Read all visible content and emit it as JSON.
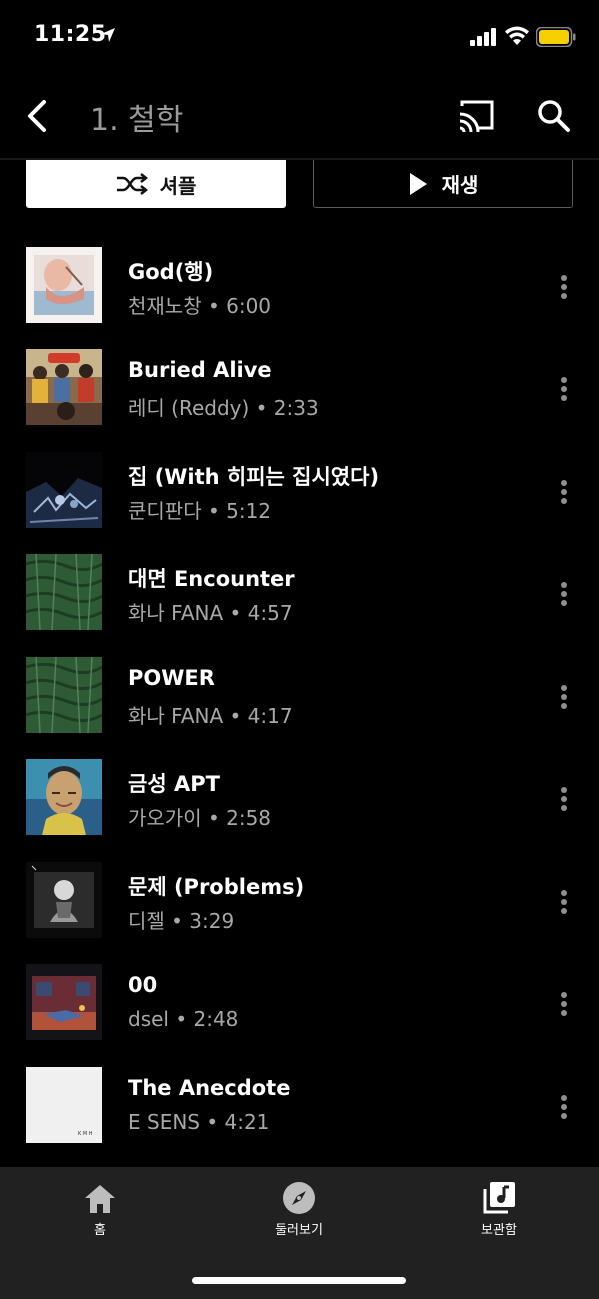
{
  "status": {
    "time": "11:25"
  },
  "header": {
    "title": "1. 철학"
  },
  "actions": {
    "shuffle_label": "셔플",
    "play_label": "재생"
  },
  "tracks": [
    {
      "title": "God(행)",
      "subtitle": "천재노창 • 6:00"
    },
    {
      "title": "Buried Alive",
      "subtitle": "레디 (Reddy) • 2:33"
    },
    {
      "title": "집 (With 히피는 집시였다)",
      "subtitle": "쿤디판다 • 5:12"
    },
    {
      "title": "대면 Encounter",
      "subtitle": "화나 FANA • 4:57"
    },
    {
      "title": "POWER",
      "subtitle": "화나 FANA • 4:17"
    },
    {
      "title": "금성 APT",
      "subtitle": "가오가이 • 2:58"
    },
    {
      "title": "문제 (Problems)",
      "subtitle": "디젤 • 3:29"
    },
    {
      "title": "00",
      "subtitle": "dsel • 2:48"
    },
    {
      "title": "The Anecdote",
      "subtitle": "E SENS • 4:21"
    }
  ],
  "album_art_text": {
    "the_anecdote": "K M H"
  },
  "nav": {
    "home": "홈",
    "explore": "둘러보기",
    "library": "보관함"
  },
  "colors": {
    "background": "#000000",
    "nav_bg": "#212121",
    "secondary_text": "#a8a8a8",
    "battery": "#f5d000"
  }
}
